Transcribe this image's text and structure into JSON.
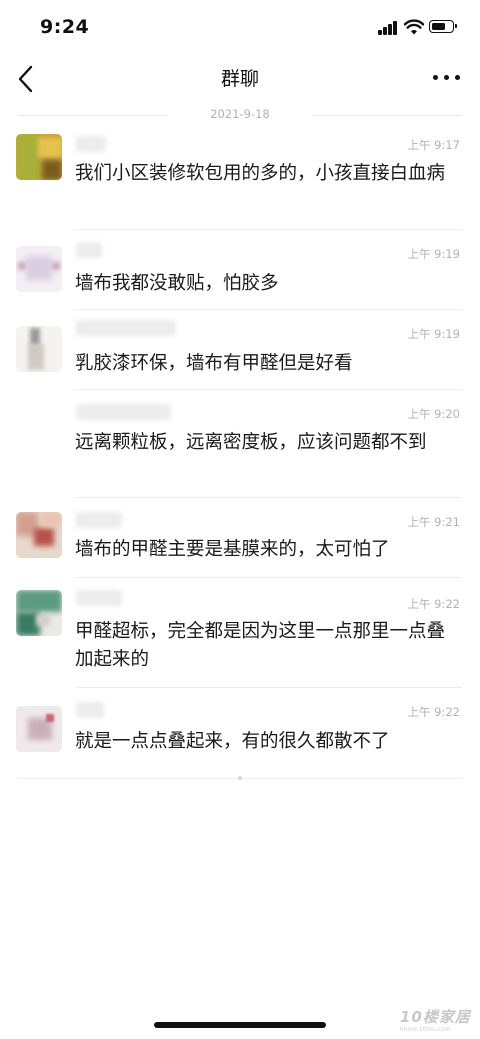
{
  "status_bar": {
    "time": "9:24"
  },
  "nav": {
    "title": "群聊"
  },
  "date_separator": "2021-9-18",
  "messages": [
    {
      "time": "上午 9:17",
      "text": "我们小区装修软包用的多的，小孩直接白血病"
    },
    {
      "time": "上午 9:19",
      "text": "墙布我都没敢贴，怕胶多"
    },
    {
      "time": "上午 9:19",
      "text": "乳胶漆环保，墙布有甲醛但是好看"
    },
    {
      "time": "上午 9:20",
      "text": "远离颗粒板，远离密度板，应该问题都不到"
    },
    {
      "time": "上午 9:21",
      "text": "墙布的甲醛主要是基膜来的，太可怕了"
    },
    {
      "time": "上午 9:22",
      "text": "甲醛超标，完全都是因为这里一点那里一点叠加起来的"
    },
    {
      "time": "上午 9:22",
      "text": "就是一点点叠起来，有的很久都散不了"
    }
  ],
  "watermark": {
    "logo": "10楼家居",
    "url": "home.10lou.com"
  }
}
